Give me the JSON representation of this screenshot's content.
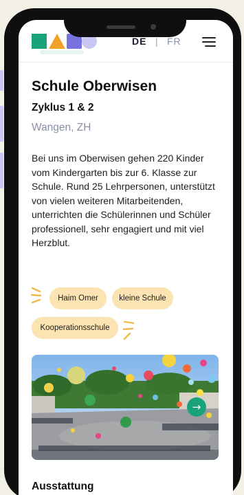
{
  "header": {
    "logo": "site-logo",
    "lang_de": "DE",
    "lang_sep": "|",
    "lang_fr": "FR",
    "menu_icon": "hamburger-menu-icon"
  },
  "school": {
    "name": "Schule Oberwisen",
    "cycle": "Zyklus 1 & 2",
    "location": "Wangen, ZH",
    "description": "Bei uns im Oberwisen gehen 220 Kinder vom Kindergarten bis zur 6. Klasse zur Schule. Rund 25 Lehrpersonen, unterstützt von vielen weiteren Mitarbeitenden, unterrichten die Schülerinnen und Schüler professionell, sehr engagiert und mit viel Herzblut."
  },
  "tags": [
    "Haim Omer",
    "kleine Schule",
    "Kooperationsschule"
  ],
  "gallery": {
    "image": "schoolyard-balloon-celebration-photo",
    "next_icon": "arrow-right-icon"
  },
  "sections": {
    "equipment_title": "Ausstattung"
  },
  "colors": {
    "brand_green": "#1aa37a",
    "brand_orange": "#f2a12a",
    "brand_violet": "#7673e0",
    "tag_bg": "#fbe3b2",
    "muted_text": "#8a8fa8"
  }
}
